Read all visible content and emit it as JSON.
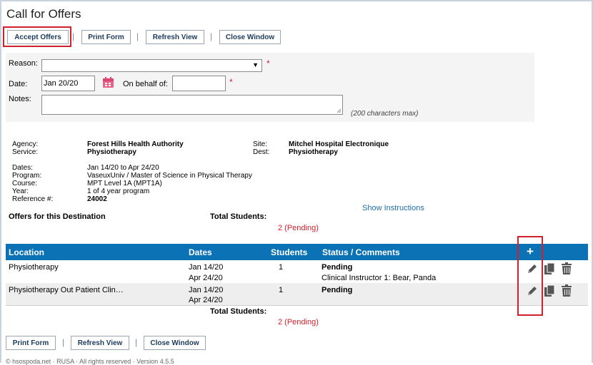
{
  "window": {
    "title": "Call for Offers"
  },
  "toolbar_top": {
    "accept_label": "Accept Offers",
    "print_label": "Print Form",
    "refresh_label": "Refresh View",
    "close_label": "Close Window"
  },
  "form": {
    "reason_label": "Reason:",
    "reason_value": "",
    "date_label": "Date:",
    "date_value": "Jan 20/20",
    "on_behalf_label": "On behalf of:",
    "on_behalf_value": "",
    "notes_label": "Notes:",
    "notes_value": "",
    "notes_max": "(200 characters max)",
    "required_marker": "*"
  },
  "info": {
    "agency_label": "Agency:",
    "agency_value": "Forest Hills Health Authority",
    "service_label": "Service:",
    "service_value": "Physiotherapy",
    "site_label": "Site:",
    "site_value": "Mitchel Hospital Electronique",
    "dest_label": "Dest:",
    "dest_value": "Physiotherapy",
    "dates_label": "Dates:",
    "dates_value": "Jan 14/20 to Apr 24/20",
    "program_label": "Program:",
    "program_value": "VaseuxUniv / Master of Science in Physical Therapy",
    "course_label": "Course:",
    "course_value": "MPT Level 1A  (MPT1A)",
    "year_label": "Year:",
    "year_value": "1 of 4 year program",
    "reference_label": "Reference #:",
    "reference_value": "24002"
  },
  "offers": {
    "heading": "Offers for this Destination",
    "total_label": "Total Students:",
    "total_value": "2 (Pending)",
    "show_instructions": "Show Instructions"
  },
  "table": {
    "headers": {
      "location": "Location",
      "dates": "Dates",
      "students": "Students",
      "status": "Status / Comments",
      "add": "+"
    },
    "rows": [
      {
        "location": "Physiotherapy",
        "date_start": "Jan 14/20",
        "date_end": "Apr 24/20",
        "students": "1",
        "status": "Pending",
        "comment": "Clinical Instructor 1: Bear, Panda"
      },
      {
        "location": "Physiotherapy Out Patient Clin…",
        "date_start": "Jan 14/20",
        "date_end": "Apr 24/20",
        "students": "1",
        "status": "Pending",
        "comment": ""
      }
    ],
    "total_label": "Total Students:",
    "total_value": "2 (Pending)"
  },
  "toolbar_bottom": {
    "print_label": "Print Form",
    "refresh_label": "Refresh View",
    "close_label": "Close Window",
    "separator": "|"
  },
  "footer": {
    "text": "© hsospoda.net · RUSA · All rights reserved · Version 4.5.5"
  },
  "colors": {
    "header_blue": "#0b72b5",
    "required_red": "#d11f2b",
    "link_blue": "#1d6ea8",
    "calendar_pink": "#e8628a"
  },
  "icons": [
    "calendar-icon",
    "plus-icon",
    "pencil-icon",
    "copy-icon",
    "trash-icon"
  ]
}
